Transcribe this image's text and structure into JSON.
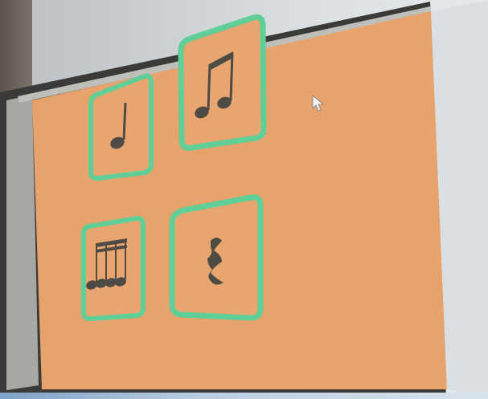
{
  "scene": {
    "description_icons": [
      "quarter-note-icon",
      "eighth-notes-icon",
      "sixteenth-notes-icon",
      "quarter-rest-icon"
    ]
  },
  "colors": {
    "slide_bg": "#e7a36b",
    "card_border": "#5fcf97",
    "card_bg": "#e8a56f",
    "note": "#4e4a44"
  }
}
